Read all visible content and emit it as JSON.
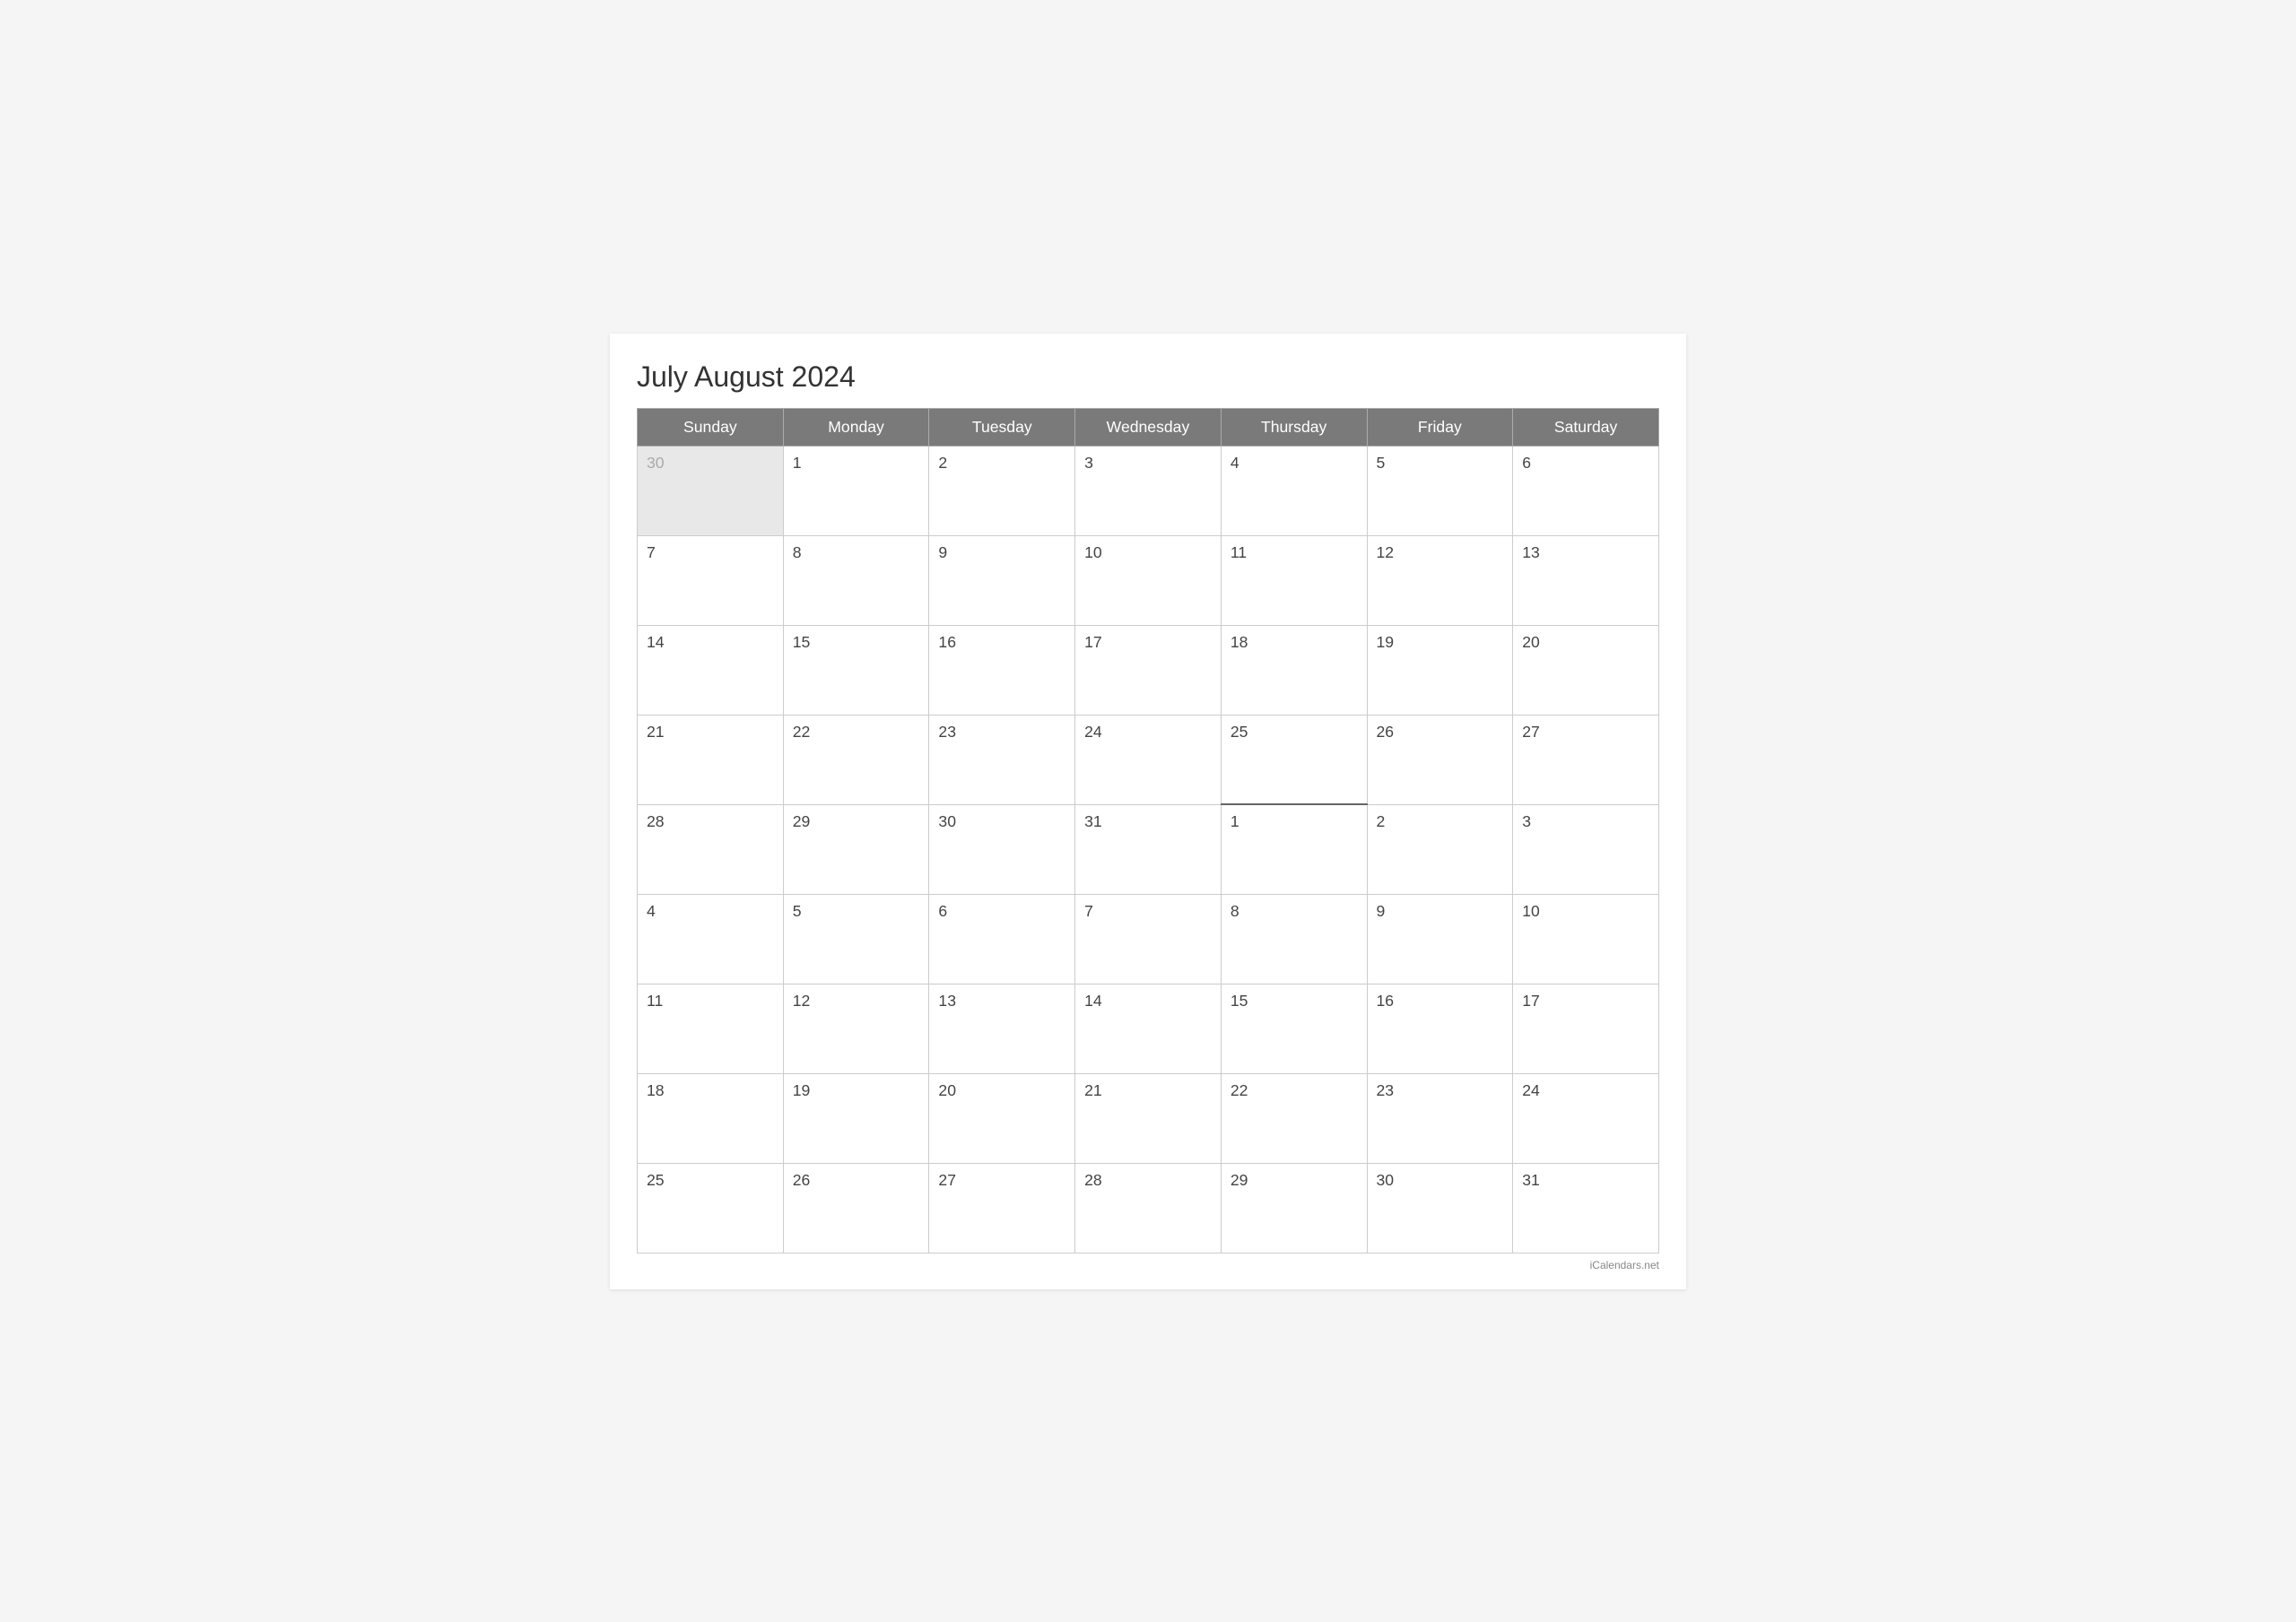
{
  "title": "July August 2024",
  "footer": "iCalendars.net",
  "headers": [
    "Sunday",
    "Monday",
    "Tuesday",
    "Wednesday",
    "Thursday",
    "Friday",
    "Saturday"
  ],
  "weeks": [
    [
      {
        "day": "30",
        "outside": true
      },
      {
        "day": "1"
      },
      {
        "day": "2"
      },
      {
        "day": "3"
      },
      {
        "day": "4"
      },
      {
        "day": "5"
      },
      {
        "day": "6"
      }
    ],
    [
      {
        "day": "7"
      },
      {
        "day": "8"
      },
      {
        "day": "9"
      },
      {
        "day": "10"
      },
      {
        "day": "11"
      },
      {
        "day": "12"
      },
      {
        "day": "13"
      }
    ],
    [
      {
        "day": "14"
      },
      {
        "day": "15"
      },
      {
        "day": "16"
      },
      {
        "day": "17"
      },
      {
        "day": "18"
      },
      {
        "day": "19"
      },
      {
        "day": "20"
      }
    ],
    [
      {
        "day": "21"
      },
      {
        "day": "22"
      },
      {
        "day": "23"
      },
      {
        "day": "24"
      },
      {
        "day": "25"
      },
      {
        "day": "26"
      },
      {
        "day": "27"
      }
    ],
    [
      {
        "day": "28"
      },
      {
        "day": "29"
      },
      {
        "day": "30"
      },
      {
        "day": "31"
      },
      {
        "day": "1",
        "transition": true
      },
      {
        "day": "2"
      },
      {
        "day": "3"
      }
    ],
    [
      {
        "day": "4"
      },
      {
        "day": "5"
      },
      {
        "day": "6"
      },
      {
        "day": "7"
      },
      {
        "day": "8"
      },
      {
        "day": "9"
      },
      {
        "day": "10"
      }
    ],
    [
      {
        "day": "11"
      },
      {
        "day": "12"
      },
      {
        "day": "13"
      },
      {
        "day": "14"
      },
      {
        "day": "15"
      },
      {
        "day": "16"
      },
      {
        "day": "17"
      }
    ],
    [
      {
        "day": "18"
      },
      {
        "day": "19"
      },
      {
        "day": "20"
      },
      {
        "day": "21"
      },
      {
        "day": "22"
      },
      {
        "day": "23"
      },
      {
        "day": "24"
      }
    ],
    [
      {
        "day": "25"
      },
      {
        "day": "26"
      },
      {
        "day": "27"
      },
      {
        "day": "28"
      },
      {
        "day": "29"
      },
      {
        "day": "30"
      },
      {
        "day": "31"
      }
    ]
  ]
}
